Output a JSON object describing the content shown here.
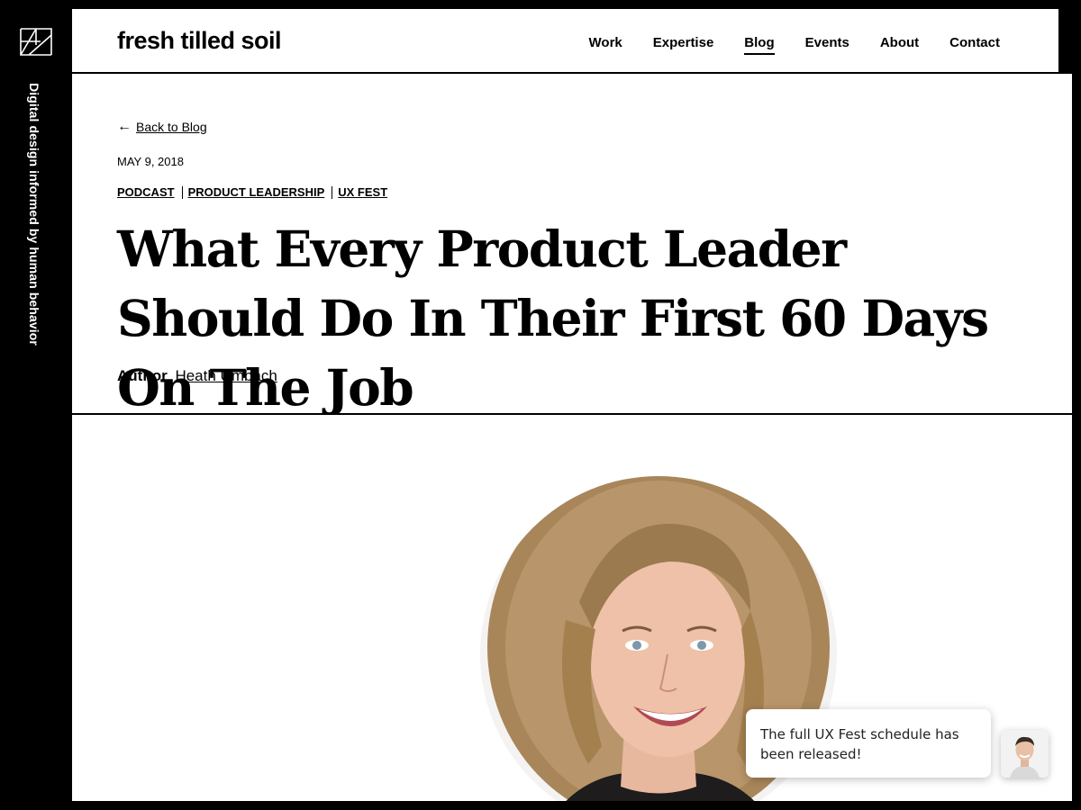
{
  "rail": {
    "logo_icon": "fresh-tilled-soil-logo-icon",
    "tagline": "Digital design informed by human behavior"
  },
  "header": {
    "brand": "fresh tilled soil",
    "nav": [
      {
        "label": "Work",
        "active": false
      },
      {
        "label": "Expertise",
        "active": false
      },
      {
        "label": "Blog",
        "active": true
      },
      {
        "label": "Events",
        "active": false
      },
      {
        "label": "About",
        "active": false
      },
      {
        "label": "Contact",
        "active": false
      }
    ]
  },
  "article": {
    "back_arrow": "←",
    "back_label": "Back to Blog",
    "date": "MAY 9, 2018",
    "tags": [
      "PODCAST",
      "PRODUCT LEADERSHIP",
      "UX FEST"
    ],
    "title": "What Every Product Leader Should Do In Their First 60 Days On The Job",
    "author_label": "Author",
    "author_name": "Heath Umbach"
  },
  "hero": {
    "image": "portrait-photo-of-smiling-woman-with-curly-hair"
  },
  "chat": {
    "message": "The full UX Fest schedule has been released!",
    "avatar": "chat-agent-avatar"
  },
  "colors": {
    "background": "#000000",
    "surface": "#ffffff",
    "text": "#000000"
  }
}
